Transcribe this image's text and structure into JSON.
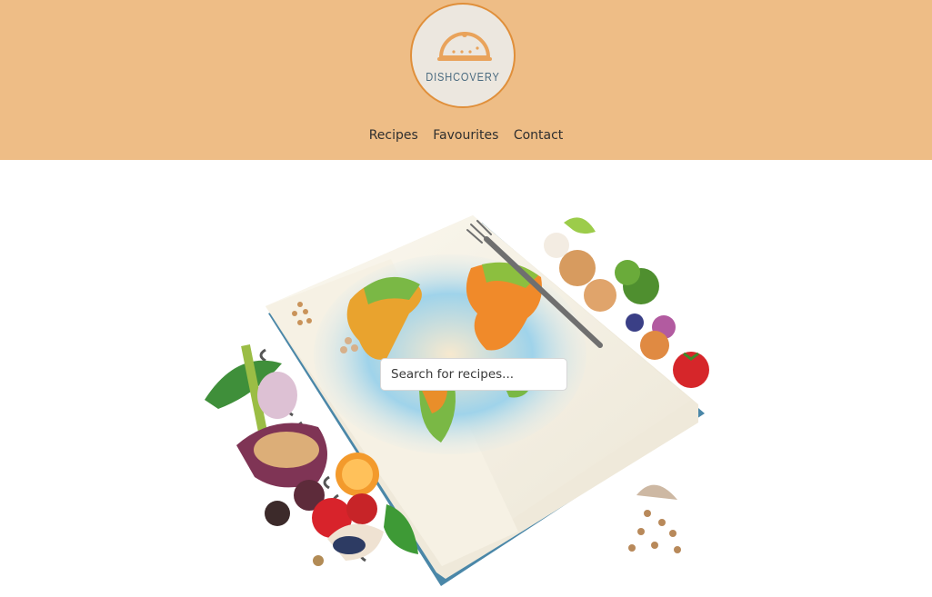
{
  "brand": {
    "name": "DISHCOVERY",
    "colors": {
      "header_bg": "#eebd86",
      "logo_ring": "#e08f3a",
      "logo_text": "#4a6b80"
    }
  },
  "nav": {
    "items": [
      {
        "label": "Recipes"
      },
      {
        "label": "Favourites"
      },
      {
        "label": "Contact"
      }
    ]
  },
  "hero": {
    "image": "open-recipe-book-with-world-map-and-vegetables",
    "search": {
      "placeholder": "Search for recipes...",
      "value": ""
    }
  }
}
